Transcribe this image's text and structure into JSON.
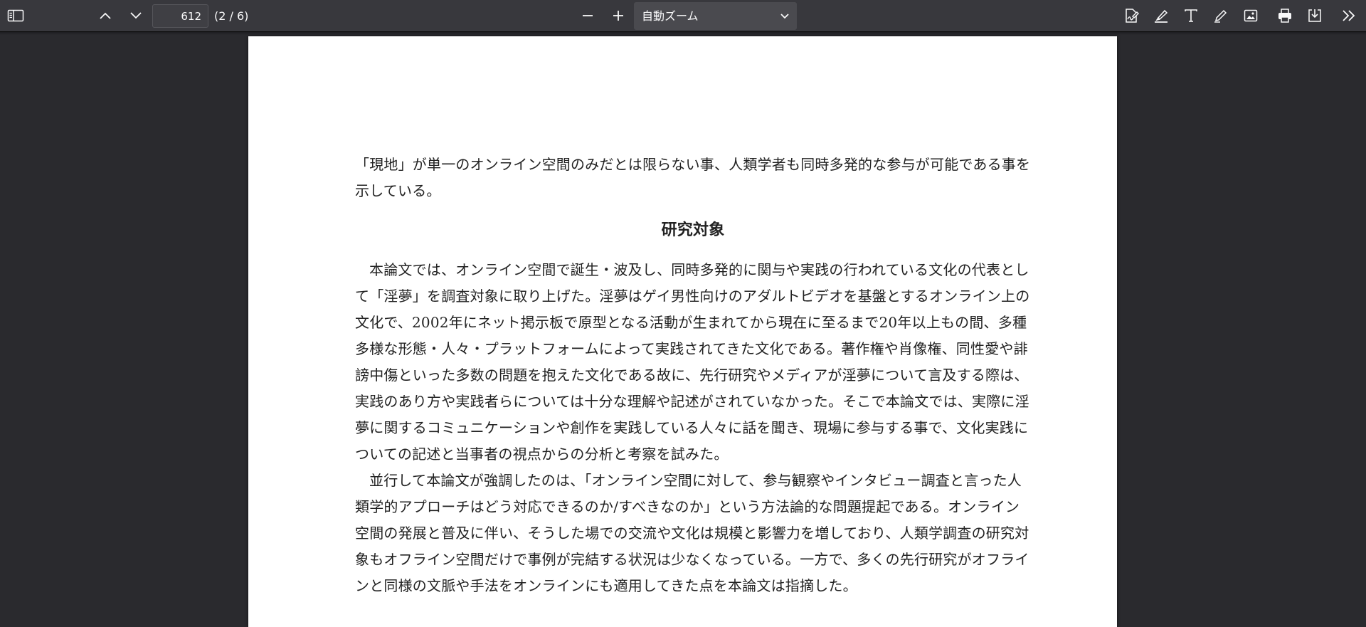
{
  "toolbar": {
    "sidebar_toggle_icon": "sidebar-toggle-icon",
    "prev_page_icon": "chevron-up-icon",
    "next_page_icon": "chevron-down-icon",
    "page_number_value": "612",
    "page_count_text": "(2 / 6)",
    "zoom_out_icon": "minus-icon",
    "zoom_in_icon": "plus-icon",
    "zoom_selected": "自動ズーム",
    "right_tools": [
      "signature-icon",
      "highlight-icon",
      "text-icon",
      "draw-icon",
      "image-icon",
      "print-icon",
      "save-icon",
      "more-tools-icon"
    ]
  },
  "document": {
    "intro_paragraph": "「現地」が単一のオンライン空間のみだとは限らない事、人類学者も同時多発的な参与が可能である事を示している。",
    "section_heading": "研究対象",
    "paragraph_1": "本論文では、オンライン空間で誕生・波及し、同時多発的に関与や実践の行われている文化の代表として「淫夢」を調査対象に取り上げた。淫夢はゲイ男性向けのアダルトビデオを基盤とするオンライン上の文化で、2002年にネット掲示板で原型となる活動が生まれてから現在に至るまで20年以上もの間、多種多様な形態・人々・プラットフォームによって実践されてきた文化である。著作権や肖像権、同性愛や誹謗中傷といった多数の問題を抱えた文化である故に、先行研究やメディアが淫夢について言及する際は、実践のあり方や実践者らについては十分な理解や記述がされていなかった。そこで本論文では、実際に淫夢に関するコミュニケーションや創作を実践している人々に話を聞き、現場に参与する事で、文化実践についての記述と当事者の視点からの分析と考察を試みた。",
    "paragraph_2": "並行して本論文が強調したのは、「オンライン空間に対して、参与観察やインタビュー調査と言った人類学的アプローチはどう対応できるのか/すべきなのか」という方法論的な問題提起である。オンライン空間の発展と普及に伴い、そうした場での交流や文化は規模と影響力を増しており、人類学調査の研究対象もオフライン空間だけで事例が完結する状況は少なくなっている。一方で、多くの先行研究がオフラインと同様の文脈や手法をオンラインにも適用してきた点を本論文は指摘した。"
  },
  "colors": {
    "toolbar_bg": "#38383d",
    "viewer_bg": "#2a2a2e",
    "icon": "#f9f9fa",
    "page_bg": "#ffffff",
    "text": "#222222"
  }
}
